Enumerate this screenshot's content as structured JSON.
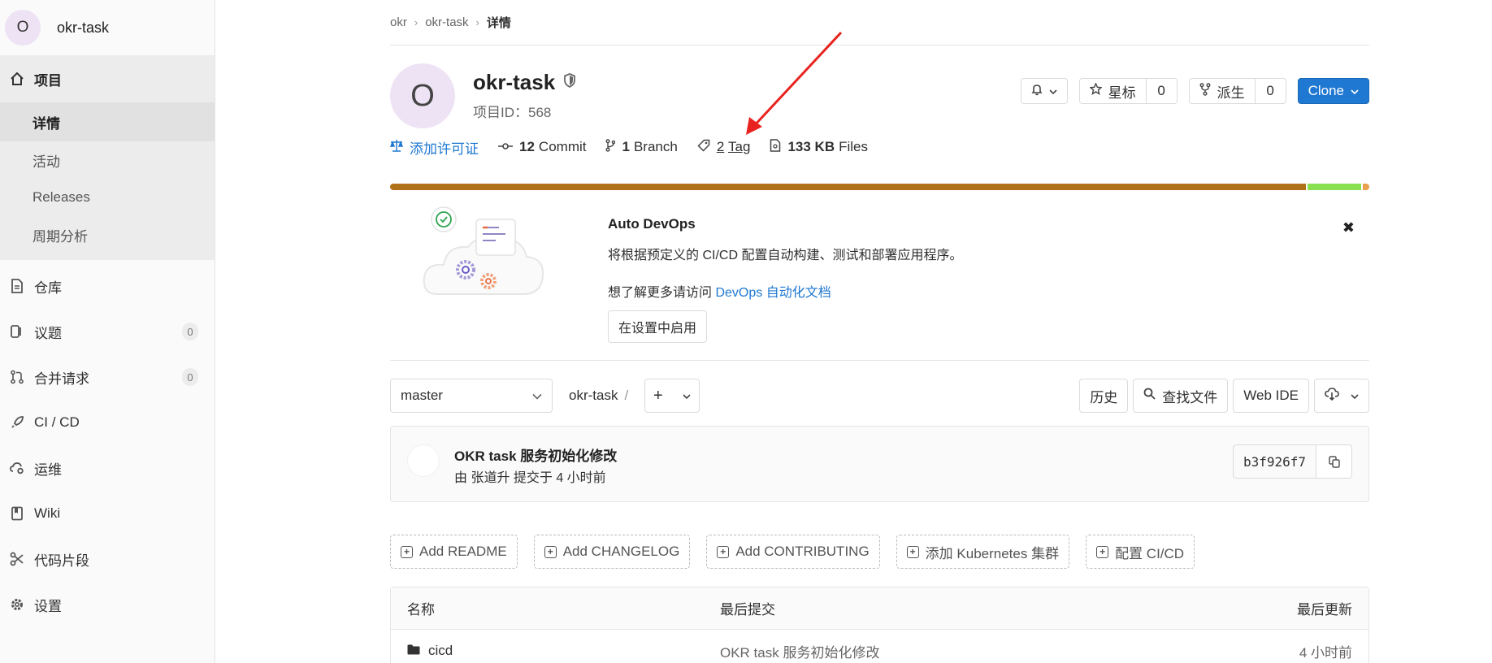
{
  "sidebar": {
    "project_initial": "O",
    "project_name": "okr-task",
    "items": [
      {
        "label": "项目",
        "icon": "home-icon"
      },
      {
        "label": "仓库",
        "icon": "document-icon"
      },
      {
        "label": "议题",
        "icon": "issues-icon",
        "badge": "0"
      },
      {
        "label": "合并请求",
        "icon": "merge-request-icon",
        "badge": "0"
      },
      {
        "label": "CI / CD",
        "icon": "rocket-icon"
      },
      {
        "label": "运维",
        "icon": "cloud-gear-icon"
      },
      {
        "label": "Wiki",
        "icon": "book-icon"
      },
      {
        "label": "代码片段",
        "icon": "scissors-icon"
      },
      {
        "label": "设置",
        "icon": "gear-icon"
      }
    ],
    "subitems": [
      "详情",
      "活动",
      "Releases",
      "周期分析"
    ]
  },
  "breadcrumb": [
    "okr",
    "okr-task",
    "详情"
  ],
  "project": {
    "initial": "O",
    "name": "okr-task",
    "id_label": "项目ID：568"
  },
  "actions": {
    "star_label": "星标",
    "star_count": "0",
    "fork_label": "派生",
    "fork_count": "0",
    "clone_label": "Clone"
  },
  "stats": {
    "license_label": "添加许可证",
    "commits_count": "12",
    "commits_label": "Commit",
    "branch_count": "1",
    "branch_label": "Branch",
    "tag_count": "2",
    "tag_label": "Tag",
    "files_size": "133 KB",
    "files_label": "Files"
  },
  "language_bar": [
    {
      "fraction": 0.935,
      "color": "#b07219"
    },
    {
      "fraction": 0.057,
      "color": "#89e051"
    },
    {
      "fraction": 0.008,
      "color": "#e8a04c"
    }
  ],
  "devops": {
    "title": "Auto DevOps",
    "description": "将根据预定义的 CI/CD 配置自动构建、测试和部署应用程序。",
    "more_prefix": "想了解更多请访问 ",
    "more_link": "DevOps 自动化文档",
    "enable_button": "在设置中启用"
  },
  "repo": {
    "branch": "master",
    "path": "okr-task",
    "history_button": "历史",
    "find_file_button": "查找文件",
    "web_ide_button": "Web IDE"
  },
  "commit": {
    "title": "OKR task 服务初始化修改",
    "meta": "由 张道升 提交于 4 小时前",
    "sha": "b3f926f7"
  },
  "quick_actions": [
    "Add README",
    "Add CHANGELOG",
    "Add CONTRIBUTING",
    "添加 Kubernetes 集群",
    "配置 CI/CD"
  ],
  "files_table": {
    "headers": [
      "名称",
      "最后提交",
      "最后更新"
    ],
    "rows": [
      {
        "name": "cicd",
        "commit": "OKR task 服务初始化修改",
        "updated": "4 小时前"
      }
    ]
  },
  "colors": {
    "accent": "#1f78d1",
    "annotation_arrow": "#e8231f"
  }
}
